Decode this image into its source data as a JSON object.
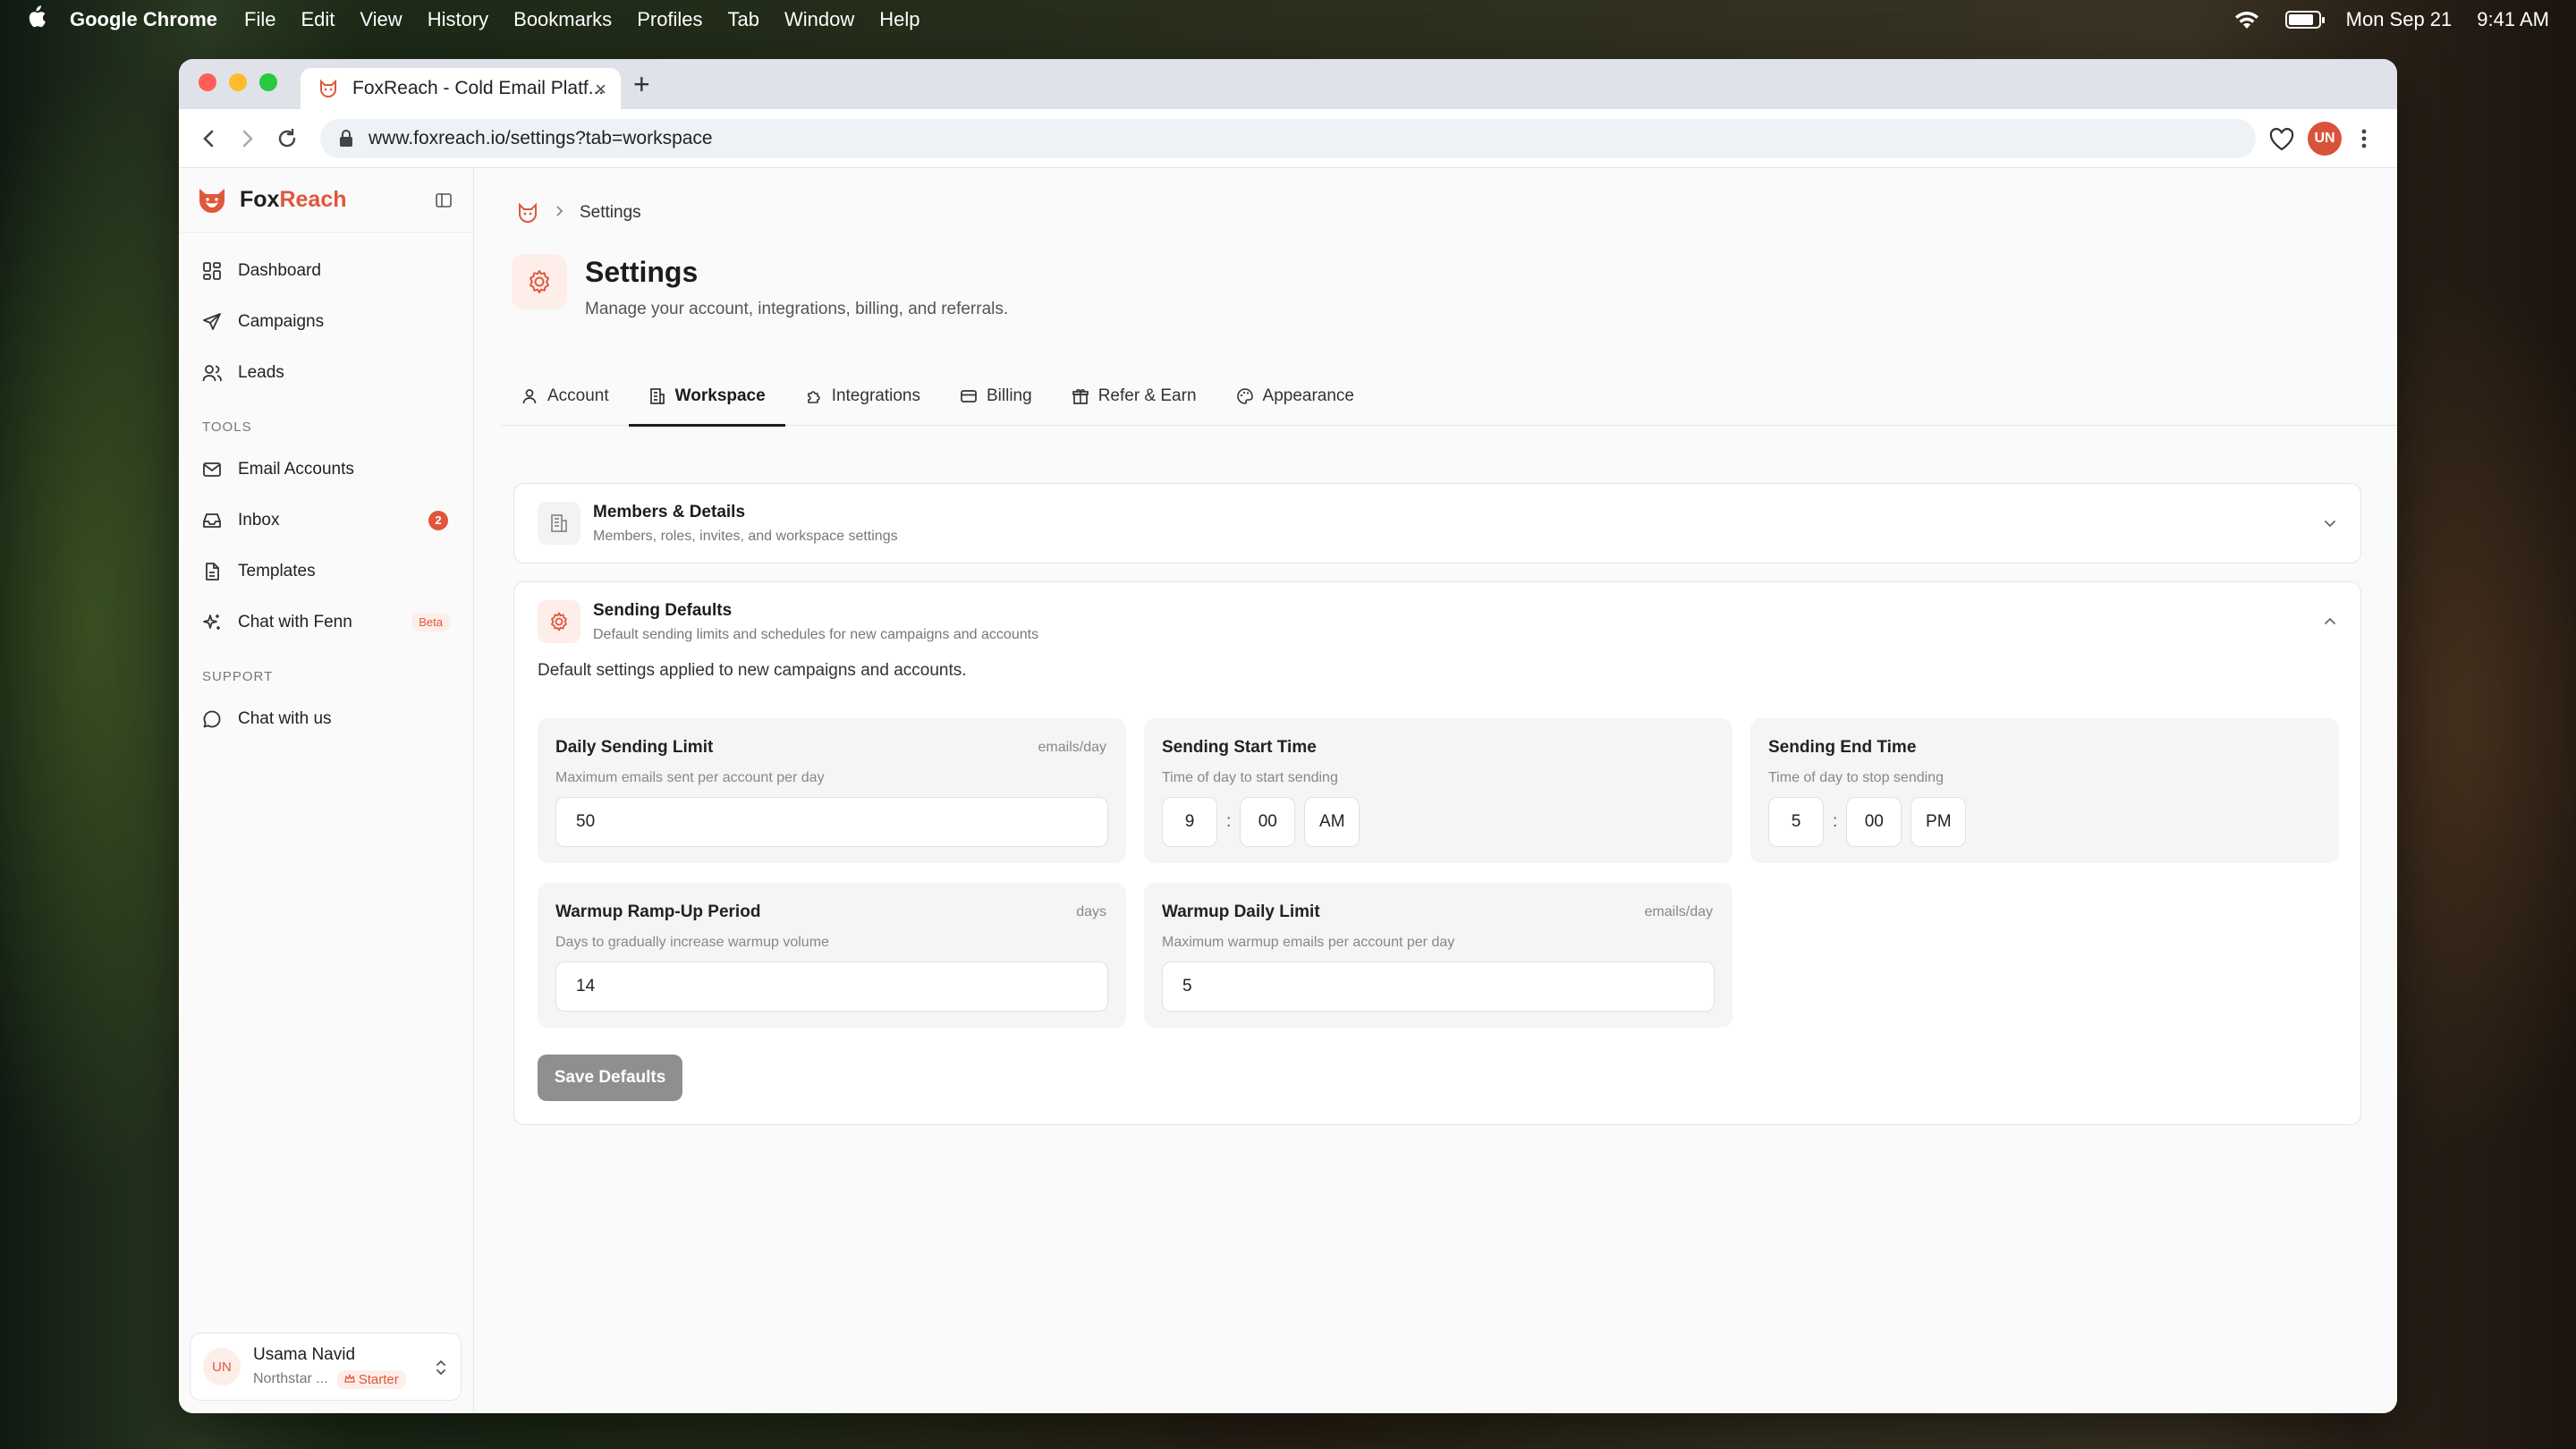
{
  "menubar": {
    "app_name": "Google Chrome",
    "items": [
      "File",
      "Edit",
      "View",
      "History",
      "Bookmarks",
      "Profiles",
      "Tab",
      "Window",
      "Help"
    ],
    "date": "Mon Sep 21",
    "time": "9:41 AM",
    "battery_level_pct": 85
  },
  "browser": {
    "tab_title": "FoxReach - Cold Email Platf...",
    "url": "www.foxreach.io/settings?tab=workspace",
    "profile_initials": "UN"
  },
  "sidebar": {
    "brand_fox": "Fox",
    "brand_reach": "Reach",
    "main_items": [
      {
        "label": "Dashboard",
        "icon": "dashboard-icon"
      },
      {
        "label": "Campaigns",
        "icon": "send-icon"
      },
      {
        "label": "Leads",
        "icon": "users-icon"
      }
    ],
    "tools_label": "TOOLS",
    "tools_items": [
      {
        "label": "Email Accounts",
        "icon": "mail-icon"
      },
      {
        "label": "Inbox",
        "icon": "inbox-icon",
        "badge": "2"
      },
      {
        "label": "Templates",
        "icon": "document-icon"
      },
      {
        "label": "Chat with Fenn",
        "icon": "sparkle-icon",
        "tag": "Beta"
      }
    ],
    "support_label": "SUPPORT",
    "support_items": [
      {
        "label": "Chat with us",
        "icon": "chat-icon"
      }
    ],
    "user": {
      "initials": "UN",
      "name": "Usama Navid",
      "workspace": "Northstar ...",
      "plan": "Starter"
    }
  },
  "main": {
    "breadcrumb": "Settings",
    "title": "Settings",
    "subtitle": "Manage your account, integrations, billing, and referrals.",
    "tabs": [
      {
        "label": "Account",
        "icon": "user-icon"
      },
      {
        "label": "Workspace",
        "icon": "building-icon",
        "active": true
      },
      {
        "label": "Integrations",
        "icon": "puzzle-icon"
      },
      {
        "label": "Billing",
        "icon": "card-icon"
      },
      {
        "label": "Refer & Earn",
        "icon": "gift-icon"
      },
      {
        "label": "Appearance",
        "icon": "palette-icon"
      }
    ],
    "members": {
      "title": "Members & Details",
      "subtitle": "Members, roles, invites, and workspace settings"
    },
    "sending": {
      "title": "Sending Defaults",
      "subtitle": "Default sending limits and schedules for new campaigns and accounts",
      "intro": "Default settings applied to new campaigns and accounts.",
      "daily_limit": {
        "label": "Daily Sending Limit",
        "unit": "emails/day",
        "help": "Maximum emails sent per account per day",
        "value": "50"
      },
      "start_time": {
        "label": "Sending Start Time",
        "help": "Time of day to start sending",
        "hour": "9",
        "minute": "00",
        "period": "AM"
      },
      "end_time": {
        "label": "Sending End Time",
        "help": "Time of day to stop sending",
        "hour": "5",
        "minute": "00",
        "period": "PM"
      },
      "warmup_period": {
        "label": "Warmup Ramp-Up Period",
        "unit": "days",
        "help": "Days to gradually increase warmup volume",
        "value": "14"
      },
      "warmup_limit": {
        "label": "Warmup Daily Limit",
        "unit": "emails/day",
        "help": "Maximum warmup emails per account per day",
        "value": "5"
      },
      "save_label": "Save Defaults"
    }
  },
  "colors": {
    "accent": "#e0573b",
    "accent_soft": "#fdeeea"
  }
}
